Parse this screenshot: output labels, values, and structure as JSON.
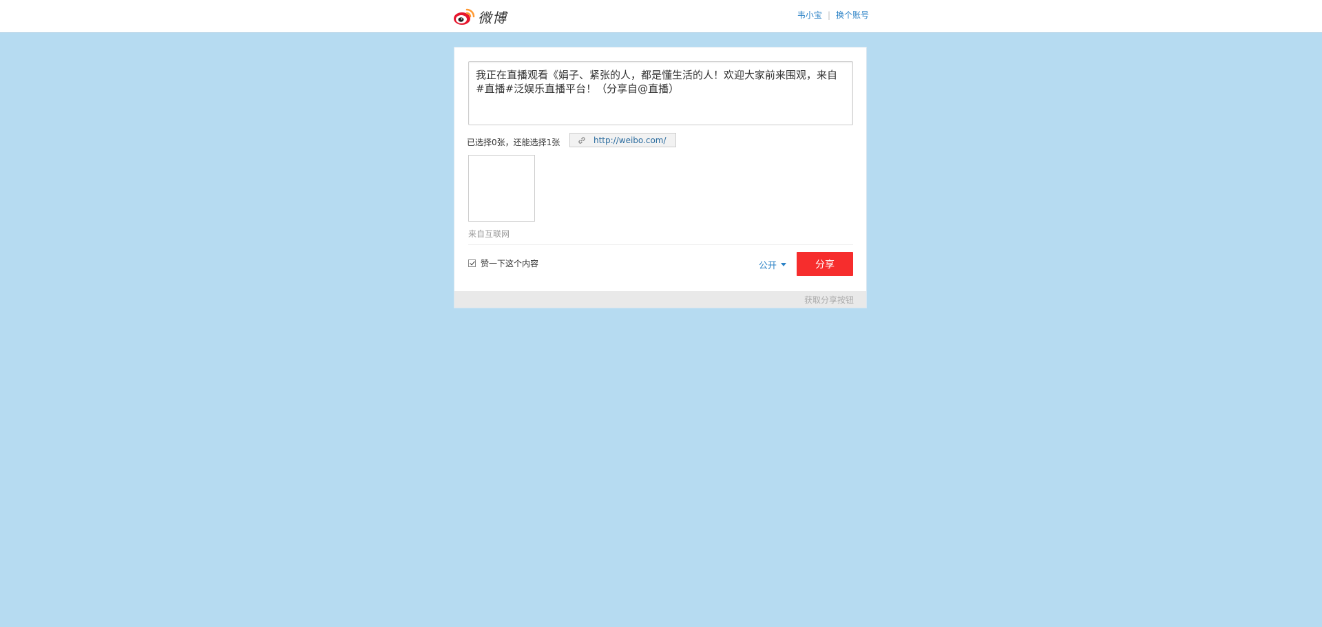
{
  "header": {
    "logo_text": "微博",
    "logo_icon": "weibo-logo-icon",
    "user_name": "韦小宝",
    "separator": "|",
    "switch_account": "换个账号"
  },
  "composer": {
    "text": "我正在直播观看《娟子、紧张的人，都是懂生活的人！欢迎大家前来围观，来自#直播#泛娱乐直播平台！（分享自@直播）"
  },
  "attachments": {
    "selected_info": "已选择0张，还能选择1张",
    "url": "http://weibo.com/",
    "url_icon": "link-icon",
    "source": "来自互联网"
  },
  "actions": {
    "like_label": "赞一下这个内容",
    "like_checked": true,
    "privacy": "公开",
    "share_button": "分享"
  },
  "footer": {
    "get_button_link": "获取分享按钮"
  },
  "colors": {
    "page_bg": "#b6dbf1",
    "share_button": "#f62d2d",
    "link": "#2b82c6"
  }
}
